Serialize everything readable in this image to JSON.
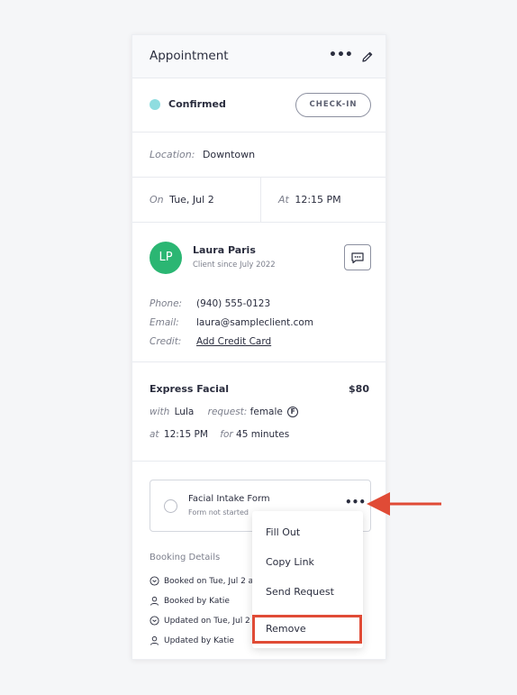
{
  "header": {
    "title": "Appointment",
    "more": "•••"
  },
  "status": {
    "label": "Confirmed",
    "dot_color": "#8fdde0",
    "checkin_label": "CHECK-IN"
  },
  "location": {
    "label": "Location:",
    "value": "Downtown"
  },
  "datetime": {
    "on_label": "On",
    "date": "Tue, Jul 2",
    "at_label": "At",
    "time": "12:15 PM"
  },
  "client": {
    "initials": "LP",
    "avatar_color": "#2bb673",
    "name": "Laura Paris",
    "since": "Client since July 2022",
    "phone_label": "Phone:",
    "phone": "(940) 555-0123",
    "email_label": "Email:",
    "email": "laura@sampleclient.com",
    "credit_label": "Credit:",
    "credit_link": "Add Credit Card"
  },
  "service": {
    "name": "Express Facial",
    "price": "$80",
    "with_label": "with",
    "provider": "Lula",
    "request_label": "request:",
    "request": "female",
    "request_badge": "F",
    "at_label": "at",
    "time": "12:15 PM",
    "for_label": "for",
    "duration": "45 minutes"
  },
  "form": {
    "title": "Facial Intake Form",
    "status": "Form not started",
    "more": "•••"
  },
  "booking": {
    "title": "Booking Details",
    "items": [
      {
        "icon": "clock-icon",
        "text": "Booked on Tue, Jul 2 a"
      },
      {
        "icon": "person-icon",
        "text": "Booked by Katie"
      },
      {
        "icon": "clock-icon",
        "text": "Updated on Tue, Jul 2"
      },
      {
        "icon": "person-icon",
        "text": "Updated by Katie"
      }
    ]
  },
  "menu": {
    "items": [
      "Fill Out",
      "Copy Link",
      "Send Request",
      "Remove"
    ],
    "highlight_color": "#e04b36"
  }
}
